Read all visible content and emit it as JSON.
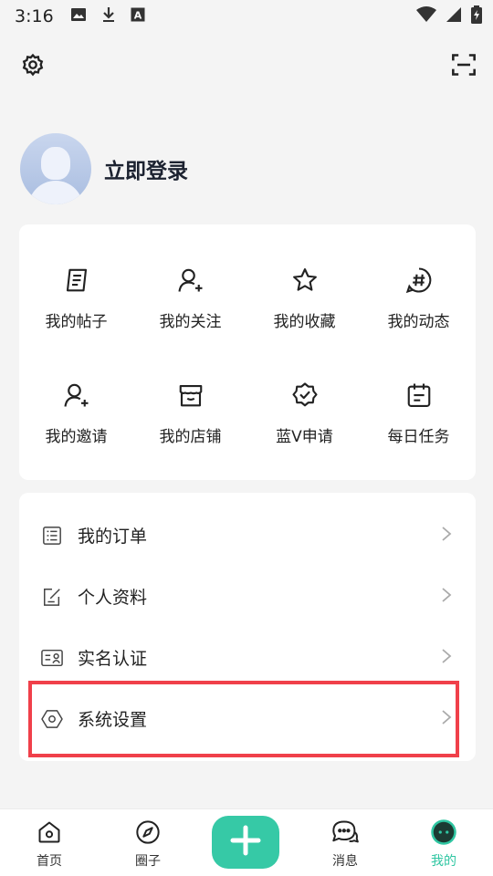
{
  "status_bar": {
    "time": "3:16",
    "icons": [
      "image-icon",
      "download-icon",
      "a-icon",
      "wifi-icon",
      "signal-icon",
      "battery-icon"
    ]
  },
  "header": {
    "settings_icon": "gear-icon",
    "scan_icon": "scan-icon"
  },
  "profile": {
    "login_label": "立即登录"
  },
  "grid": {
    "items": [
      {
        "label": "我的帖子",
        "icon": "document-icon"
      },
      {
        "label": "我的关注",
        "icon": "user-plus-icon"
      },
      {
        "label": "我的收藏",
        "icon": "star-icon"
      },
      {
        "label": "我的动态",
        "icon": "hashtag-icon"
      },
      {
        "label": "我的邀请",
        "icon": "user-plus-icon"
      },
      {
        "label": "我的店铺",
        "icon": "store-icon"
      },
      {
        "label": "蓝V申请",
        "icon": "badge-check-icon"
      },
      {
        "label": "每日任务",
        "icon": "calendar-icon"
      }
    ]
  },
  "list": {
    "items": [
      {
        "label": "我的订单",
        "icon": "order-icon"
      },
      {
        "label": "个人资料",
        "icon": "edit-icon"
      },
      {
        "label": "实名认证",
        "icon": "id-card-icon"
      },
      {
        "label": "系统设置",
        "icon": "hexagon-icon"
      }
    ]
  },
  "tabbar": {
    "tabs": [
      {
        "label": "首页",
        "icon": "home-icon"
      },
      {
        "label": "圈子",
        "icon": "compass-icon"
      },
      {
        "label": "消息",
        "icon": "chat-icon"
      },
      {
        "label": "我的",
        "icon": "face-icon"
      }
    ],
    "active_color": "#2fc6a2",
    "fab_icon": "plus-icon",
    "fab_color": "#36c9a6"
  },
  "colors": {
    "highlight": "#f0404a",
    "background": "#f4f4f4"
  }
}
